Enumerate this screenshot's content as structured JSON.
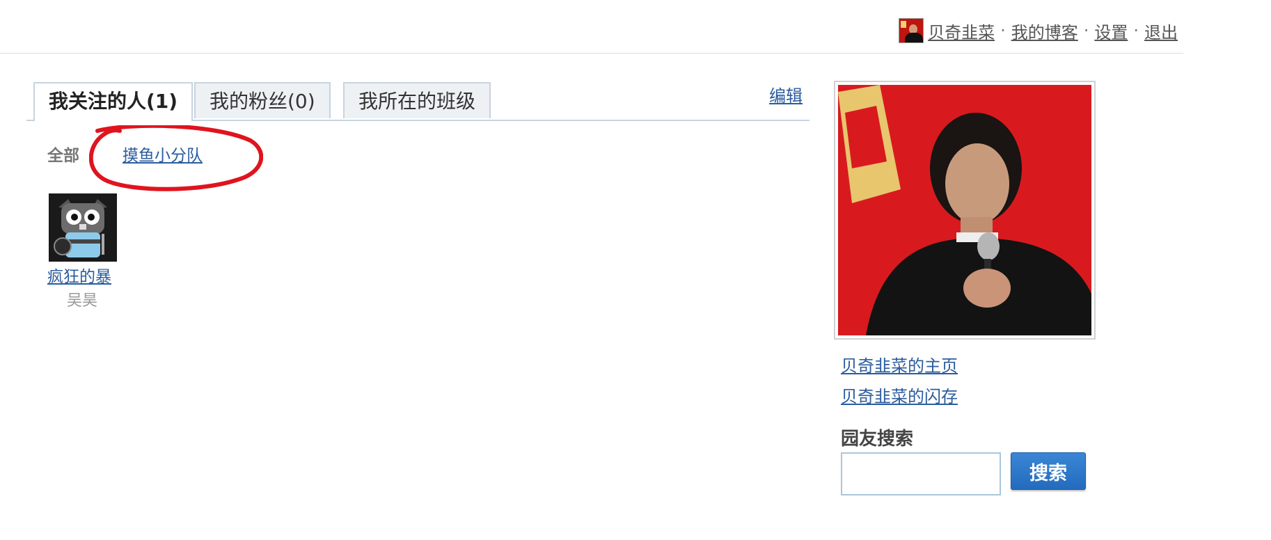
{
  "topbar": {
    "username": "贝奇韭菜",
    "my_blog": "我的博客",
    "settings": "设置",
    "logout": "退出",
    "separator": "·"
  },
  "tabs": [
    {
      "label": "我关注的人(1)",
      "active": true
    },
    {
      "label": "我的粉丝(0)",
      "active": false
    },
    {
      "label": "我所在的班级",
      "active": false
    }
  ],
  "edit_label": "编辑",
  "groups": {
    "all_label": "全部",
    "group_label": "摸鱼小分队"
  },
  "following": [
    {
      "name": "疯狂的暴",
      "sub": "吴昊"
    }
  ],
  "sidebar": {
    "homepage_link": "贝奇韭菜的主页",
    "flash_link": "贝奇韭菜的闪存",
    "search_title": "园友搜索",
    "search_value": "",
    "search_button": "搜索"
  },
  "colors": {
    "link": "#2b5c9e",
    "tab_border": "#c7d3e0",
    "button": "#236bbd",
    "annotation": "#e0141e"
  }
}
